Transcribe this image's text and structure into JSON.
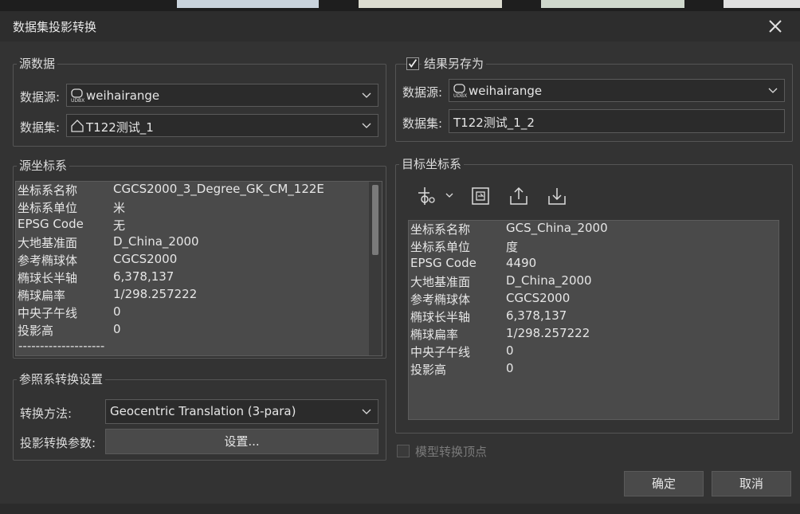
{
  "window": {
    "title": "数据集投影转换"
  },
  "source": {
    "group_label": "源数据",
    "datasource_label": "数据源:",
    "datasource_value": "weihairange",
    "datasource_icon": "udbx-datasource-icon",
    "dataset_label": "数据集:",
    "dataset_value": "T122测试_1",
    "dataset_icon": "region-dataset-icon"
  },
  "source_crs": {
    "group_label": "源坐标系",
    "rows": [
      {
        "k": "坐标系名称",
        "v": "CGCS2000_3_Degree_GK_CM_122E"
      },
      {
        "k": "坐标系单位",
        "v": "米"
      },
      {
        "k": "EPSG Code",
        "v": "无"
      },
      {
        "k": "大地基准面",
        "v": "D_China_2000"
      },
      {
        "k": "参考椭球体",
        "v": "CGCS2000"
      },
      {
        "k": "椭球长半轴",
        "v": "6,378,137"
      },
      {
        "k": "椭球扁率",
        "v": "1/298.257222"
      },
      {
        "k": "中央子午线",
        "v": "0"
      },
      {
        "k": "投影高",
        "v": "0"
      }
    ],
    "separator": "--------------------"
  },
  "transform": {
    "group_label": "参照系转换设置",
    "method_label": "转换方法:",
    "method_value": "Geocentric Translation (3-para)",
    "params_label": "投影转换参数:",
    "settings_button": "设置..."
  },
  "result": {
    "save_as_label": "结果另存为",
    "save_as_checked": true,
    "datasource_label": "数据源:",
    "datasource_value": "weihairange",
    "dataset_label": "数据集:",
    "dataset_value": "T122测试_1_2"
  },
  "target_crs": {
    "group_label": "目标坐标系",
    "toolbar": [
      "crs-settings-icon",
      "select-crs-icon",
      "export-icon",
      "import-icon"
    ],
    "rows": [
      {
        "k": "坐标系名称",
        "v": "GCS_China_2000"
      },
      {
        "k": "坐标系单位",
        "v": "度"
      },
      {
        "k": "EPSG Code",
        "v": "4490"
      },
      {
        "k": "大地基准面",
        "v": "D_China_2000"
      },
      {
        "k": "参考椭球体",
        "v": "CGCS2000"
      },
      {
        "k": "椭球长半轴",
        "v": "6,378,137"
      },
      {
        "k": "椭球扁率",
        "v": "1/298.257222"
      },
      {
        "k": "中央子午线",
        "v": "0"
      },
      {
        "k": "投影高",
        "v": "0"
      }
    ]
  },
  "options": {
    "model_vertex_label": "模型转换顶点",
    "model_vertex_checked": false
  },
  "buttons": {
    "ok": "确定",
    "cancel": "取消"
  },
  "colors": {
    "background": "#333333",
    "panel": "#4a4a4a",
    "border": "#5a5a5a",
    "text": "#dcdcdc"
  }
}
